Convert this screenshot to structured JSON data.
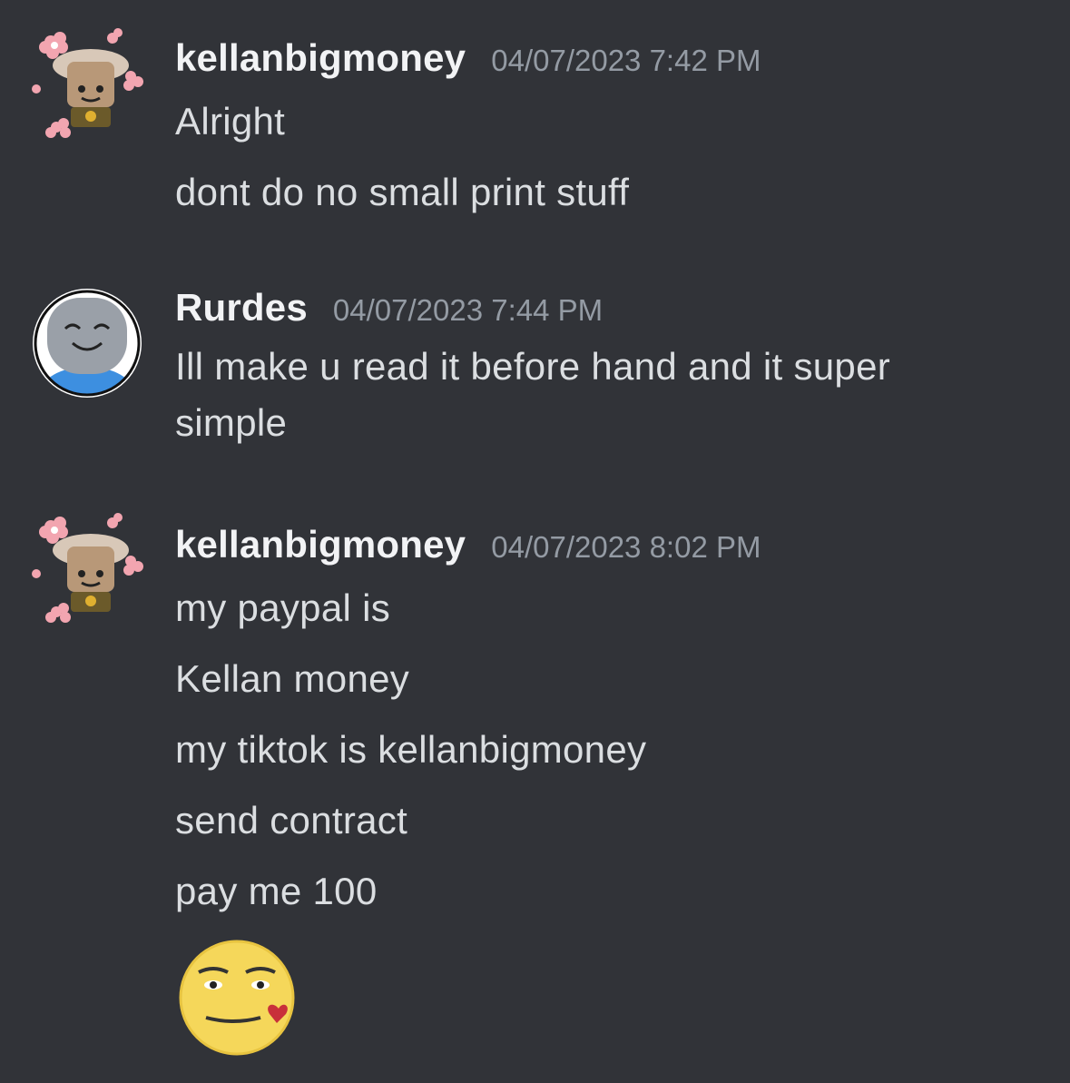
{
  "messages": [
    {
      "username": "kellanbigmoney",
      "timestamp": "04/07/2023 7:42 PM",
      "avatar": "flower-roblox-avatar-icon",
      "lines": [
        "Alright",
        "dont do no small print stuff"
      ]
    },
    {
      "username": "Rurdes",
      "timestamp": "04/07/2023 7:44 PM",
      "avatar": "smiling-roblox-avatar-icon",
      "lines": [
        "Ill make u read it before hand and it super",
        "simple"
      ]
    },
    {
      "username": "kellanbigmoney",
      "timestamp": "04/07/2023 8:02 PM",
      "avatar": "flower-roblox-avatar-icon",
      "lines": [
        "my paypal is",
        "Kellan money",
        "my tiktok is kellanbigmoney",
        "send contract",
        "pay me 100"
      ],
      "emoji": "kissing-face-emoji-icon"
    }
  ],
  "colors": {
    "background": "#313338",
    "username": "#f2f3f5",
    "timestamp": "#949ba4",
    "text": "#dbdee1"
  }
}
